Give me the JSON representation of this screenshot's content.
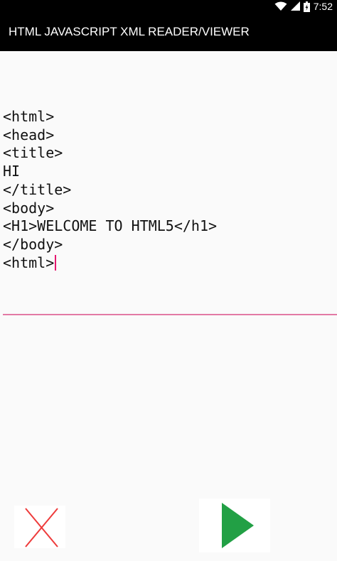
{
  "status_bar": {
    "time": "7:52",
    "icons": [
      "wifi-icon",
      "signal-icon",
      "battery-icon"
    ]
  },
  "app_bar": {
    "title": "HTML JAVASCRIPT XML READER/VIEWER"
  },
  "editor": {
    "lines": [
      "<html>",
      "<head>",
      "<title>",
      "HI",
      "</title>",
      "<body>",
      "<H1>WELCOME TO HTML5</h1>",
      "</body>",
      "<html>"
    ],
    "underline_color": "#e27aa5",
    "cursor_color": "#e5176f"
  },
  "buttons": {
    "clear": {
      "icon": "close-icon",
      "color": "#ee3b3b"
    },
    "run": {
      "icon": "play-icon",
      "color": "#22a045"
    }
  }
}
